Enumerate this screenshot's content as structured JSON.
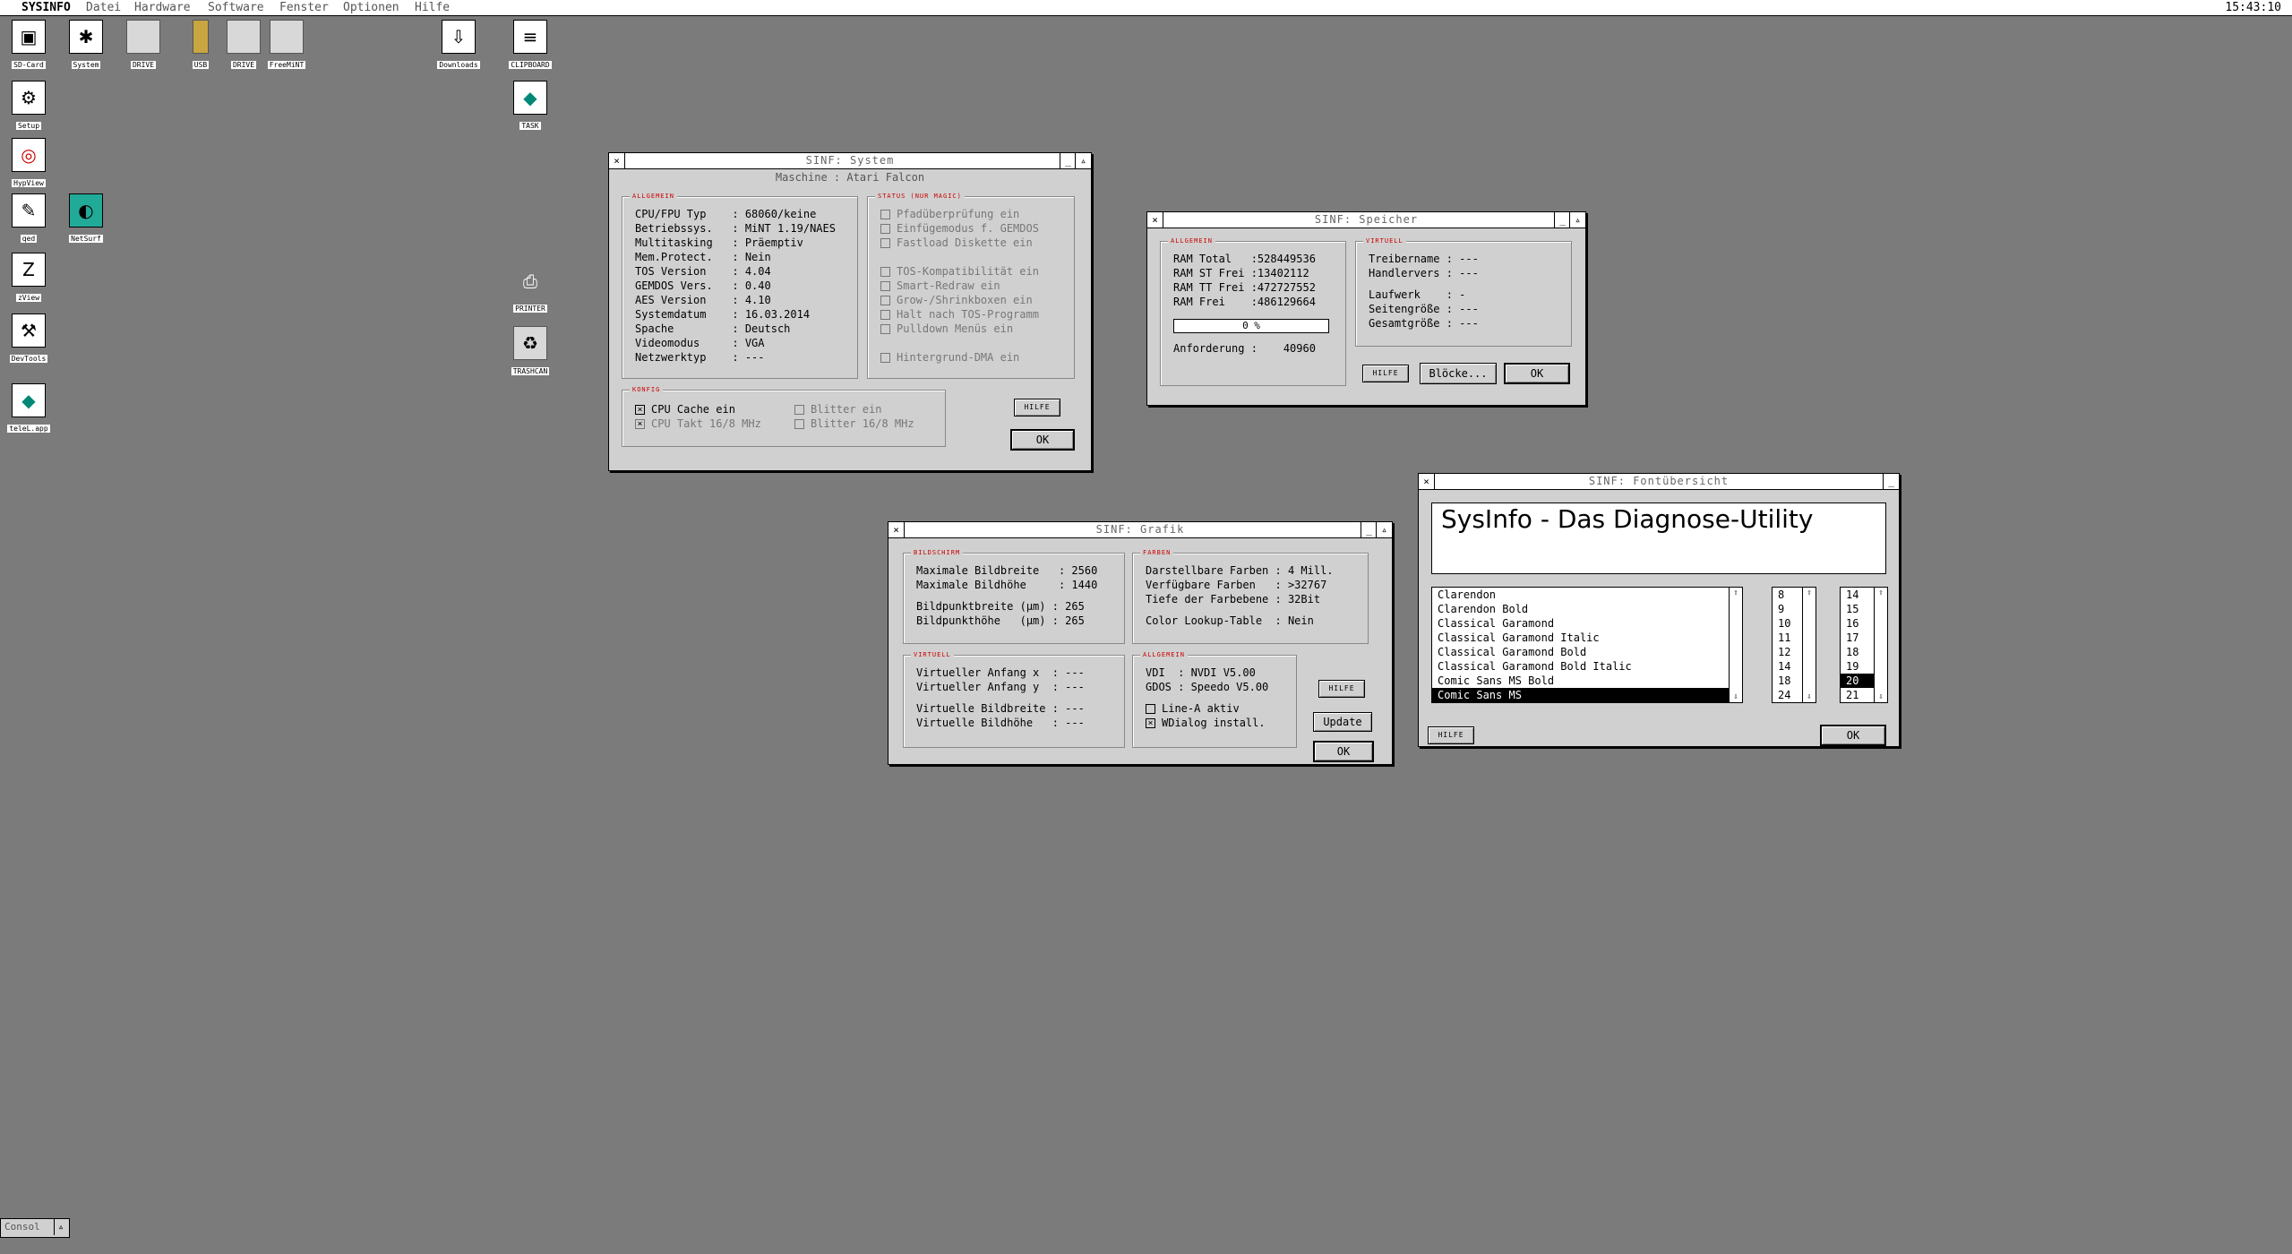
{
  "menubar": {
    "app": "SYSINFO",
    "items": [
      "Datei",
      "Hardware",
      "Software",
      "Fenster",
      "Optionen",
      "Hilfe"
    ],
    "clock": "15:43:10"
  },
  "desktop_icons": [
    "SD-Card",
    "System",
    "DRIVE",
    "USB",
    "DRIVE",
    "FreeMiNT",
    "Downloads",
    "CLIPBOARD",
    "TASK",
    "Setup",
    "HypView",
    "qed",
    "NetSurf",
    "zView",
    "DevTools",
    "teleL.app",
    "PRINTER",
    "TRASHCAN"
  ],
  "win_system": {
    "title": "SINF: System",
    "machine": "Maschine : Atari Falcon",
    "allgemein_title": "ALLGEMEIN",
    "rows": [
      "CPU/FPU Typ    : 68060/keine",
      "Betriebssys.   : MiNT 1.19/NAES",
      "Multitasking   : Präemptiv",
      "Mem.Protect.   : Nein",
      "TOS Version    : 4.04",
      "GEMDOS Vers.   : 0.40",
      "AES Version    : 4.10",
      "Systemdatum    : 16.03.2014",
      "Spache         : Deutsch",
      "Videomodus     : VGA",
      "Netzwerktyp    : ---"
    ],
    "status_title": "STATUS (NUR MAGIC)",
    "status": [
      "Pfadüberprüfung ein",
      "Einfügemodus f. GEMDOS",
      "Fastload Diskette ein",
      "TOS-Kompatibilität ein",
      "Smart-Redraw ein",
      "Grow-/Shrinkboxen ein",
      "Halt nach TOS-Programm",
      "Pulldown Menüs ein",
      "Hintergrund-DMA ein"
    ],
    "konfig_title": "KONFIG",
    "konfig": [
      "CPU Cache ein",
      "CPU Takt 16/8 MHz",
      "Blitter ein",
      "Blitter 16/8 MHz"
    ],
    "help": "HILFE",
    "ok": "OK"
  },
  "win_speicher": {
    "title": "SINF: Speicher",
    "allgemein_title": "ALLGEMEIN",
    "rows": [
      "RAM Total   :528449536",
      "RAM ST Frei :13402112",
      "RAM TT Frei :472727552",
      "RAM Frei    :486129664"
    ],
    "progress": "0 %",
    "anforderung": "Anforderung :    40960",
    "virtuell_title": "VIRTUELL",
    "virt_rows": [
      "Treibername : ---",
      "Handlervers : ---",
      "Laufwerk    : -",
      "Seitengröße : ---",
      "Gesamtgröße : ---"
    ],
    "help": "HILFE",
    "bloecke": "Blöcke...",
    "ok": "OK"
  },
  "win_grafik": {
    "title": "SINF: Grafik",
    "bild_title": "BILDSCHIRM",
    "bild_rows": [
      "Maximale Bildbreite   : 2560",
      "Maximale Bildhöhe     : 1440",
      "Bildpunktbreite (µm) : 265",
      "Bildpunkthöhe   (µm) : 265"
    ],
    "farben_title": "FARBEN",
    "farben_rows": [
      "Darstellbare Farben : 4 Mill.",
      "Verfügbare Farben   : >32767",
      "Tiefe der Farbebene : 32Bit",
      "Color Lookup-Table  : Nein"
    ],
    "virt_title": "VIRTUELL",
    "virt_rows": [
      "Virtueller Anfang x  : ---",
      "Virtueller Anfang y  : ---",
      "Virtuelle Bildbreite : ---",
      "Virtuelle Bildhöhe   : ---"
    ],
    "allg_title": "ALLGEMEIN",
    "allg_rows": [
      "VDI  : NVDI V5.00",
      "GDOS : Speedo V5.00"
    ],
    "checks": [
      "Line-A aktiv",
      "WDialog install."
    ],
    "help": "HILFE",
    "update": "Update",
    "ok": "OK"
  },
  "win_font": {
    "title": "SINF: Fontübersicht",
    "preview": "SysInfo - Das Diagnose-Utility",
    "fonts": [
      "Clarendon",
      "Clarendon Bold",
      "Classical Garamond",
      "Classical Garamond Italic",
      "Classical Garamond Bold",
      "Classical Garamond Bold Italic",
      "Comic Sans MS Bold",
      "Comic Sans MS"
    ],
    "sizes1": [
      "8",
      "9",
      "10",
      "11",
      "12",
      "14",
      "18",
      "24"
    ],
    "sizes2": [
      "14",
      "15",
      "16",
      "17",
      "18",
      "19",
      "20",
      "21"
    ],
    "help": "HILFE",
    "ok": "OK"
  },
  "taskbar": {
    "label": "Consol"
  },
  "colors": {
    "desktop": "#7b7b7b",
    "window_bg": "#d0d0d0",
    "group_title": "#cc0000"
  }
}
